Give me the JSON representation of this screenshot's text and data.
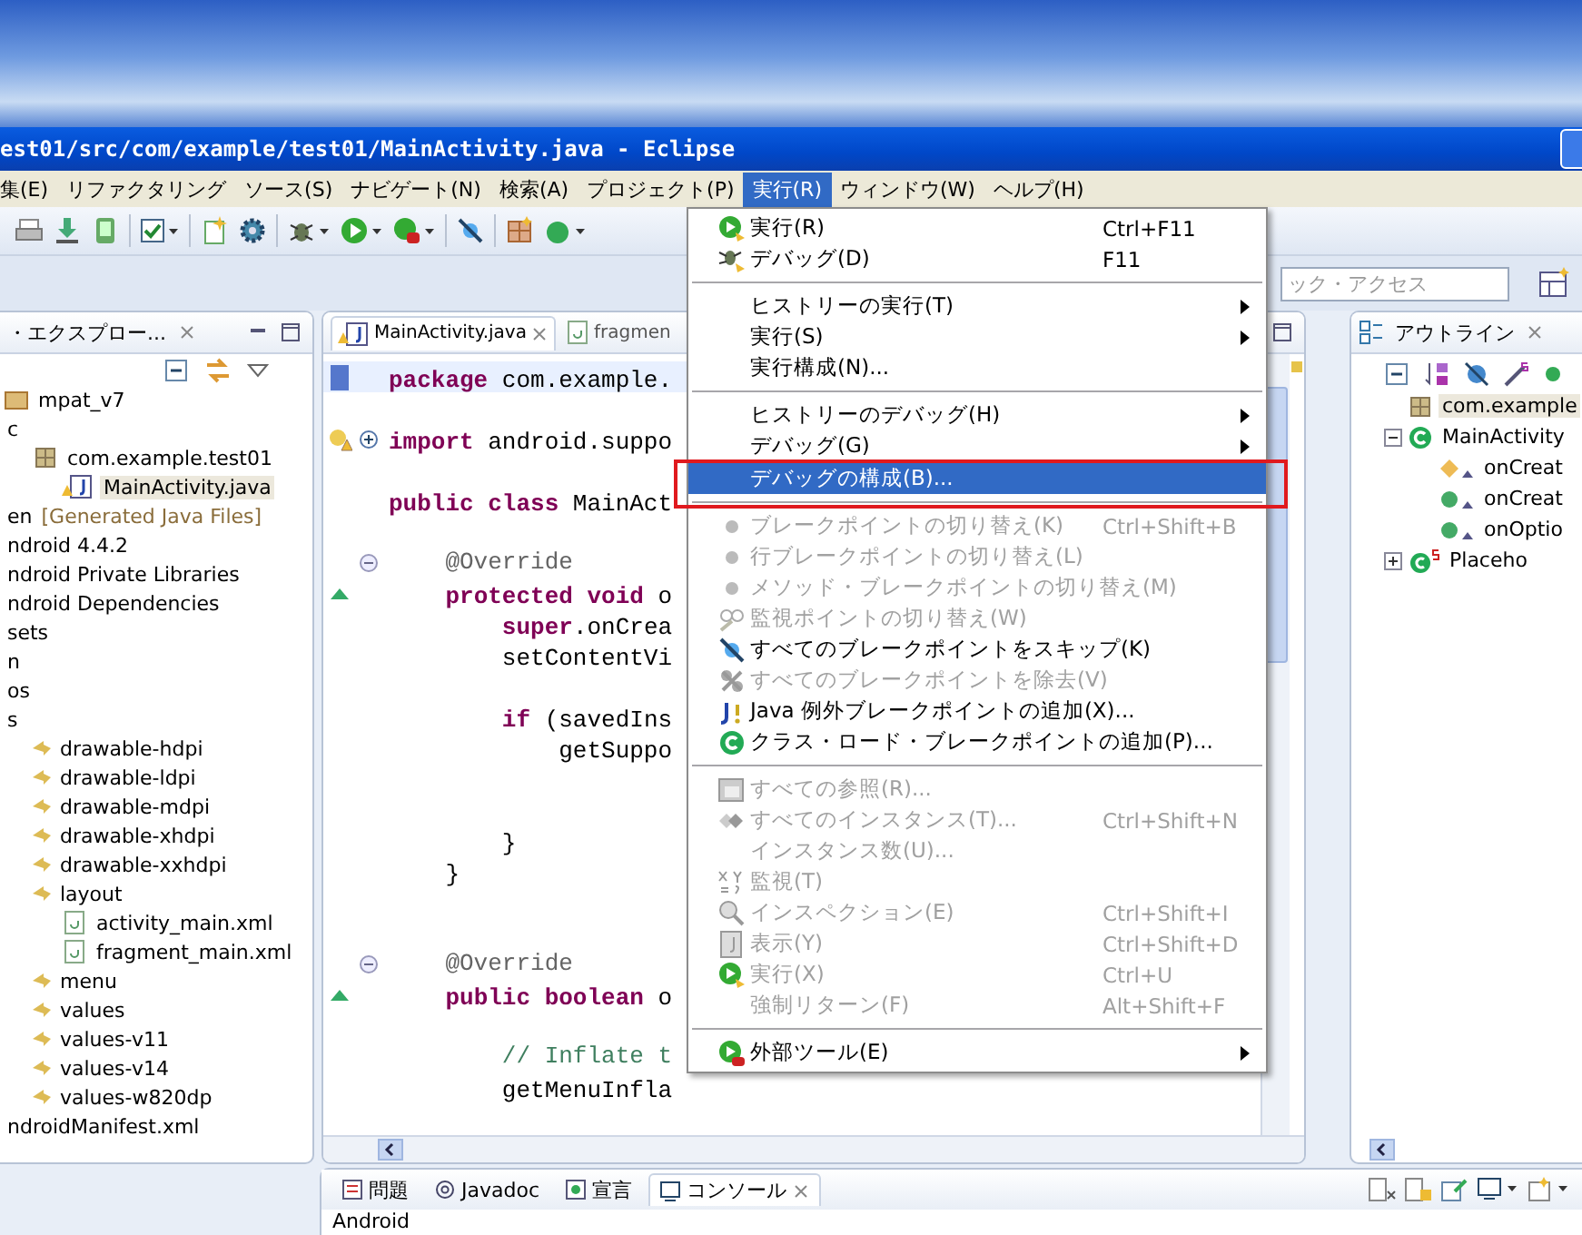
{
  "window": {
    "title": "est01/src/com/example/test01/MainActivity.java - Eclipse"
  },
  "menubar": [
    {
      "label": "集(E)",
      "selected": false
    },
    {
      "label": "リファクタリング",
      "selected": false
    },
    {
      "label": "ソース(S)",
      "selected": false
    },
    {
      "label": "ナビゲート(N)",
      "selected": false
    },
    {
      "label": "検索(A)",
      "selected": false
    },
    {
      "label": "プロジェクト(P)",
      "selected": false
    },
    {
      "label": "実行(R)",
      "selected": true
    },
    {
      "label": "ウィンドウ(W)",
      "selected": false
    },
    {
      "label": "ヘルプ(H)",
      "selected": false
    }
  ],
  "quick_access": {
    "placeholder": "ック・アクセス"
  },
  "explorer": {
    "title": "・エクスプロー...",
    "tree": [
      {
        "label": "mpat_v7",
        "kind": "project",
        "selected": false
      },
      {
        "label": "c",
        "kind": "plain",
        "selected": false,
        "children": [
          {
            "label": "com.example.test01",
            "kind": "package",
            "selected": false,
            "children": [
              {
                "label": "MainActivity.java",
                "kind": "java",
                "selected": true
              }
            ]
          }
        ]
      },
      {
        "label": "en",
        "suffix": "[Generated Java Files]",
        "kind": "plain",
        "selected": false
      },
      {
        "label": "ndroid 4.4.2",
        "kind": "plain",
        "selected": false
      },
      {
        "label": "ndroid Private Libraries",
        "kind": "plain",
        "selected": false
      },
      {
        "label": "ndroid Dependencies",
        "kind": "plain",
        "selected": false
      },
      {
        "label": "sets",
        "kind": "plain",
        "selected": false
      },
      {
        "label": "n",
        "kind": "plain",
        "selected": false
      },
      {
        "label": "os",
        "kind": "plain",
        "selected": false
      },
      {
        "label": "s",
        "kind": "plain",
        "selected": false,
        "children": [
          {
            "label": "drawable-hdpi",
            "kind": "folder",
            "selected": false
          },
          {
            "label": "drawable-ldpi",
            "kind": "folder",
            "selected": false
          },
          {
            "label": "drawable-mdpi",
            "kind": "folder",
            "selected": false
          },
          {
            "label": "drawable-xhdpi",
            "kind": "folder",
            "selected": false
          },
          {
            "label": "drawable-xxhdpi",
            "kind": "folder",
            "selected": false
          },
          {
            "label": "layout",
            "kind": "folder",
            "selected": false,
            "children": [
              {
                "label": "activity_main.xml",
                "kind": "xml",
                "selected": false
              },
              {
                "label": "fragment_main.xml",
                "kind": "xml",
                "selected": false
              }
            ]
          },
          {
            "label": "menu",
            "kind": "folder",
            "selected": false
          },
          {
            "label": "values",
            "kind": "folder",
            "selected": false
          },
          {
            "label": "values-v11",
            "kind": "folder",
            "selected": false
          },
          {
            "label": "values-v14",
            "kind": "folder",
            "selected": false
          },
          {
            "label": "values-w820dp",
            "kind": "folder",
            "selected": false
          }
        ]
      },
      {
        "label": "ndroidManifest.xml",
        "kind": "plain",
        "selected": false
      }
    ]
  },
  "editor": {
    "tabs": [
      {
        "label": "MainActivity.java",
        "selected": true
      },
      {
        "label": "fragmen",
        "selected": false
      }
    ],
    "lines": [
      {
        "text": "**package** com.example.",
        "kind": "code",
        "current": true
      },
      {
        "current": false
      },
      {
        "text": "**import** android.suppo",
        "kind": "code",
        "current": false,
        "collapsed": true,
        "warning": true
      },
      {
        "current": false
      },
      {
        "text": "**public class** MainAct",
        "kind": "code",
        "current": false
      },
      {
        "current": false
      },
      {
        "text": "    @Override",
        "kind": "annotation",
        "current": false,
        "collapsed": false
      },
      {
        "text": "    **protected void** o",
        "kind": "code",
        "current": false,
        "override": true
      },
      {
        "text": "        **super**.onCrea",
        "kind": "code",
        "current": false
      },
      {
        "text": "        setContentVi",
        "kind": "code",
        "current": false
      },
      {
        "current": false
      },
      {
        "text": "        **if** (savedIns",
        "kind": "code",
        "current": false
      },
      {
        "text": "            getSuppo",
        "kind": "code",
        "current": false
      },
      {
        "current": false
      },
      {
        "current": false
      },
      {
        "text": "        }",
        "kind": "code",
        "current": false
      },
      {
        "text": "    }",
        "kind": "code",
        "current": false
      },
      {
        "current": false
      },
      {
        "current": false
      },
      {
        "text": "    @Override",
        "kind": "annotation",
        "current": false,
        "collapsed": false
      },
      {
        "text": "    **public boolean** o",
        "kind": "code",
        "current": false,
        "override": true
      },
      {
        "current": false
      },
      {
        "text": "        // Inflate t",
        "kind": "comment",
        "current": false
      },
      {
        "text": "        getMenuInfla",
        "kind": "code",
        "current": false
      }
    ]
  },
  "run_menu": [
    {
      "kind": "item",
      "label": "実行(R)",
      "shortcut": "Ctrl+F11",
      "submenu": false,
      "disabled": false,
      "selected": false
    },
    {
      "kind": "item",
      "label": "デバッグ(D)",
      "shortcut": "F11",
      "submenu": false,
      "disabled": false,
      "selected": false
    },
    {
      "kind": "separator"
    },
    {
      "kind": "item",
      "label": "ヒストリーの実行(T)",
      "submenu": true,
      "disabled": false,
      "selected": false
    },
    {
      "kind": "item",
      "label": "実行(S)",
      "submenu": true,
      "disabled": false,
      "selected": false
    },
    {
      "kind": "item",
      "label": "実行構成(N)...",
      "submenu": false,
      "disabled": false,
      "selected": false
    },
    {
      "kind": "separator"
    },
    {
      "kind": "item",
      "label": "ヒストリーのデバッグ(H)",
      "submenu": true,
      "disabled": false,
      "selected": false
    },
    {
      "kind": "item",
      "label": "デバッグ(G)",
      "submenu": true,
      "disabled": false,
      "selected": false
    },
    {
      "kind": "item",
      "label": "デバッグの構成(B)...",
      "submenu": false,
      "disabled": false,
      "selected": true,
      "highlighted": true
    },
    {
      "kind": "separator"
    },
    {
      "kind": "item",
      "label": "ブレークポイントの切り替え(K)",
      "shortcut": "Ctrl+Shift+B",
      "submenu": false,
      "disabled": true,
      "selected": false
    },
    {
      "kind": "item",
      "label": "行ブレークポイントの切り替え(L)",
      "submenu": false,
      "disabled": true,
      "selected": false
    },
    {
      "kind": "item",
      "label": "メソッド・ブレークポイントの切り替え(M)",
      "submenu": false,
      "disabled": true,
      "selected": false
    },
    {
      "kind": "item",
      "label": "監視ポイントの切り替え(W)",
      "submenu": false,
      "disabled": true,
      "selected": false
    },
    {
      "kind": "item",
      "label": "すべてのブレークポイントをスキップ(K)",
      "submenu": false,
      "disabled": false,
      "selected": false
    },
    {
      "kind": "item",
      "label": "すべてのブレークポイントを除去(V)",
      "submenu": false,
      "disabled": true,
      "selected": false
    },
    {
      "kind": "item",
      "label": "Java 例外ブレークポイントの追加(X)...",
      "submenu": false,
      "disabled": false,
      "selected": false
    },
    {
      "kind": "item",
      "label": "クラス・ロード・ブレークポイントの追加(P)...",
      "submenu": false,
      "disabled": false,
      "selected": false
    },
    {
      "kind": "separator"
    },
    {
      "kind": "item",
      "label": "すべての参照(R)...",
      "submenu": false,
      "disabled": true,
      "selected": false
    },
    {
      "kind": "item",
      "label": "すべてのインスタンス(T)...",
      "shortcut": "Ctrl+Shift+N",
      "submenu": false,
      "disabled": true,
      "selected": false
    },
    {
      "kind": "item",
      "label": "インスタンス数(U)...",
      "submenu": false,
      "disabled": true,
      "selected": false
    },
    {
      "kind": "item",
      "label": "監視(T)",
      "submenu": false,
      "disabled": true,
      "selected": false
    },
    {
      "kind": "item",
      "label": "インスペクション(E)",
      "shortcut": "Ctrl+Shift+I",
      "submenu": false,
      "disabled": true,
      "selected": false
    },
    {
      "kind": "item",
      "label": "表示(Y)",
      "shortcut": "Ctrl+Shift+D",
      "submenu": false,
      "disabled": true,
      "selected": false
    },
    {
      "kind": "item",
      "label": "実行(X)",
      "shortcut": "Ctrl+U",
      "submenu": false,
      "disabled": true,
      "selected": false
    },
    {
      "kind": "item",
      "label": "強制リターン(F)",
      "shortcut": "Alt+Shift+F",
      "submenu": false,
      "disabled": true,
      "selected": false
    },
    {
      "kind": "separator"
    },
    {
      "kind": "item",
      "label": "外部ツール(E)",
      "submenu": true,
      "disabled": false,
      "selected": false
    }
  ],
  "outline": {
    "title": "アウトライン",
    "tree": [
      {
        "label": "com.example",
        "kind": "package",
        "selected": true
      },
      {
        "label": "MainActivity",
        "kind": "class",
        "selected": false,
        "expanded": true,
        "children": [
          {
            "label": "onCreat",
            "kind": "protected",
            "selected": false
          },
          {
            "label": "onCreat",
            "kind": "public",
            "selected": false
          },
          {
            "label": "onOptio",
            "kind": "public",
            "selected": false
          }
        ]
      },
      {
        "label": "Placeho",
        "kind": "static-class",
        "selected": false,
        "expanded": false
      }
    ]
  },
  "bottom_panel": {
    "tabs": [
      {
        "label": "問題",
        "selected": false
      },
      {
        "label": "Javadoc",
        "selected": false
      },
      {
        "label": "宣言",
        "selected": false
      },
      {
        "label": "コンソール",
        "selected": true
      }
    ],
    "console_text": "Android"
  }
}
